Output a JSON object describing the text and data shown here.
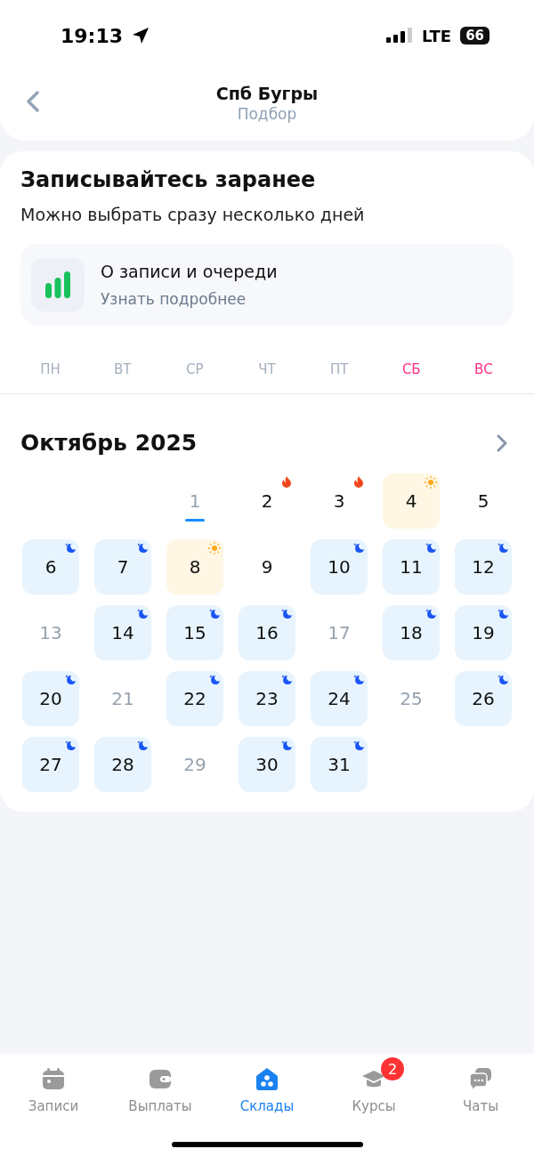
{
  "status_bar": {
    "time": "19:13",
    "network": "LTE",
    "battery": "66"
  },
  "header": {
    "title": "Спб Бугры",
    "subtitle": "Подбор"
  },
  "intro": {
    "title": "Записывайтесь заранее",
    "text": "Можно выбрать сразу несколько дней"
  },
  "info_card": {
    "title": "О записи и очереди",
    "link": "Узнать подробнее"
  },
  "weekdays": [
    {
      "label": "ПН",
      "weekend": false
    },
    {
      "label": "ВТ",
      "weekend": false
    },
    {
      "label": "СР",
      "weekend": false
    },
    {
      "label": "ЧТ",
      "weekend": false
    },
    {
      "label": "ПТ",
      "weekend": false
    },
    {
      "label": "СБ",
      "weekend": true
    },
    {
      "label": "ВС",
      "weekend": true
    }
  ],
  "calendar": {
    "month": "Октябрь 2025",
    "days": [
      {
        "label": "1",
        "kind": "today"
      },
      {
        "label": "2",
        "kind": "hot"
      },
      {
        "label": "3",
        "kind": "hot"
      },
      {
        "label": "4",
        "kind": "day"
      },
      {
        "label": "5",
        "kind": "plain"
      },
      {
        "label": "6",
        "kind": "night"
      },
      {
        "label": "7",
        "kind": "night"
      },
      {
        "label": "8",
        "kind": "day"
      },
      {
        "label": "9",
        "kind": "plain"
      },
      {
        "label": "10",
        "kind": "night"
      },
      {
        "label": "11",
        "kind": "night"
      },
      {
        "label": "12",
        "kind": "night"
      },
      {
        "label": "13",
        "kind": "unavailable"
      },
      {
        "label": "14",
        "kind": "night"
      },
      {
        "label": "15",
        "kind": "night"
      },
      {
        "label": "16",
        "kind": "night"
      },
      {
        "label": "17",
        "kind": "unavailable"
      },
      {
        "label": "18",
        "kind": "night"
      },
      {
        "label": "19",
        "kind": "night"
      },
      {
        "label": "20",
        "kind": "night"
      },
      {
        "label": "21",
        "kind": "unavailable"
      },
      {
        "label": "22",
        "kind": "night"
      },
      {
        "label": "23",
        "kind": "night"
      },
      {
        "label": "24",
        "kind": "night"
      },
      {
        "label": "25",
        "kind": "unavailable"
      },
      {
        "label": "26",
        "kind": "night"
      },
      {
        "label": "27",
        "kind": "night"
      },
      {
        "label": "28",
        "kind": "night"
      },
      {
        "label": "29",
        "kind": "unavailable"
      },
      {
        "label": "30",
        "kind": "night"
      },
      {
        "label": "31",
        "kind": "night"
      }
    ]
  },
  "tab_bar": [
    {
      "label": "Записи",
      "selected": false
    },
    {
      "label": "Выплаты",
      "selected": false
    },
    {
      "label": "Склады",
      "selected": true
    },
    {
      "label": "Курсы",
      "selected": false,
      "badge": "2"
    },
    {
      "label": "Чаты",
      "selected": false
    }
  ]
}
